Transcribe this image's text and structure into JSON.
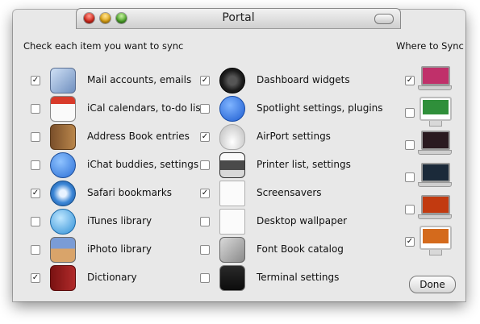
{
  "window": {
    "title": "Portal"
  },
  "headings": {
    "sync_items": "Check each item you want to sync",
    "where": "Where to Sync"
  },
  "items_left": [
    {
      "label": "Mail accounts, emails",
      "checked": true,
      "icon": "mail-stamp-icon"
    },
    {
      "label": "iCal calendars, to-do list",
      "checked": false,
      "icon": "ical-calendar-icon"
    },
    {
      "label": "Address Book entries",
      "checked": false,
      "icon": "address-book-icon"
    },
    {
      "label": "iChat buddies, settings",
      "checked": false,
      "icon": "ichat-bubble-icon"
    },
    {
      "label": "Safari bookmarks",
      "checked": true,
      "icon": "safari-compass-icon"
    },
    {
      "label": "iTunes library",
      "checked": false,
      "icon": "itunes-music-icon"
    },
    {
      "label": "iPhoto library",
      "checked": false,
      "icon": "iphoto-camera-icon"
    },
    {
      "label": "Dictionary",
      "checked": true,
      "icon": "dictionary-book-icon"
    }
  ],
  "items_right": [
    {
      "label": "Dashboard widgets",
      "checked": true,
      "icon": "dashboard-gauge-icon"
    },
    {
      "label": "Spotlight settings, plugins",
      "checked": false,
      "icon": "spotlight-search-icon"
    },
    {
      "label": "AirPort settings",
      "checked": true,
      "icon": "airport-base-icon"
    },
    {
      "label": "Printer list, settings",
      "checked": false,
      "icon": "printer-icon"
    },
    {
      "label": "Screensavers",
      "checked": true,
      "icon": "screensaver-document-icon"
    },
    {
      "label": "Desktop wallpaper",
      "checked": false,
      "icon": "wallpaper-document-icon"
    },
    {
      "label": "Font Book catalog",
      "checked": false,
      "icon": "font-book-icon"
    },
    {
      "label": "Terminal settings",
      "checked": false,
      "icon": "terminal-icon"
    }
  ],
  "destinations": [
    {
      "checked": true,
      "icon": "macbook-pink-icon",
      "screen": "#c0306a"
    },
    {
      "checked": false,
      "icon": "imac-green-icon",
      "screen": "#2f8f3a"
    },
    {
      "checked": false,
      "icon": "macbook-dark-icon",
      "screen": "#2a1a20"
    },
    {
      "checked": false,
      "icon": "macbook-black-icon",
      "screen": "#1b2a3a"
    },
    {
      "checked": false,
      "icon": "macbook-red-icon",
      "screen": "#c23a10"
    },
    {
      "checked": true,
      "icon": "imac-orange-icon",
      "screen": "#d46a1c"
    }
  ],
  "buttons": {
    "done": "Done"
  }
}
